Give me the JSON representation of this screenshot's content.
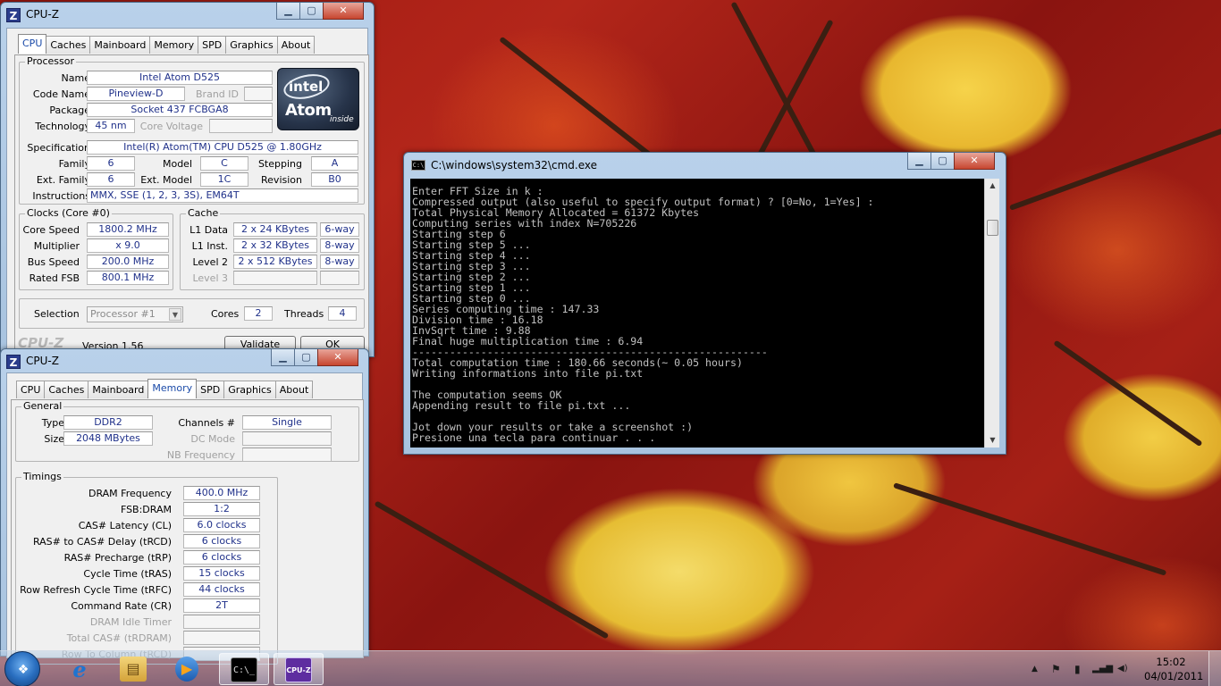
{
  "cpuz1": {
    "title": "CPU-Z",
    "controls": {
      "min": "▁",
      "max": "▢",
      "close": "✕"
    },
    "tabs": [
      "CPU",
      "Caches",
      "Mainboard",
      "Memory",
      "SPD",
      "Graphics",
      "About"
    ],
    "active_tab": "CPU",
    "processor": {
      "group_title": "Processor",
      "name_label": "Name",
      "name": "Intel Atom D525",
      "codename_label": "Code Name",
      "codename": "Pineview-D",
      "brandid_label": "Brand ID",
      "brandid": "",
      "package_label": "Package",
      "package": "Socket 437 FCBGA8",
      "technology_label": "Technology",
      "technology": "45 nm",
      "corevoltage_label": "Core Voltage",
      "corevoltage": "",
      "spec_label": "Specification",
      "spec": "Intel(R) Atom(TM) CPU D525   @ 1.80GHz",
      "family_label": "Family",
      "family": "6",
      "model_label": "Model",
      "model": "C",
      "stepping_label": "Stepping",
      "stepping": "A",
      "extfamily_label": "Ext. Family",
      "extfamily": "6",
      "extmodel_label": "Ext. Model",
      "extmodel": "1C",
      "revision_label": "Revision",
      "revision": "B0",
      "instructions_label": "Instructions",
      "instructions": "MMX, SSE (1, 2, 3, 3S), EM64T",
      "logo": {
        "brand": "intel",
        "product": "Atom",
        "suffix": "inside"
      }
    },
    "clocks": {
      "group_title": "Clocks (Core #0)",
      "corespeed_label": "Core Speed",
      "corespeed": "1800.2 MHz",
      "multiplier_label": "Multiplier",
      "multiplier": "x 9.0",
      "busspeed_label": "Bus Speed",
      "busspeed": "200.0 MHz",
      "ratedfsb_label": "Rated FSB",
      "ratedfsb": "800.1 MHz"
    },
    "cache": {
      "group_title": "Cache",
      "l1data_label": "L1 Data",
      "l1data": "2 x 24 KBytes",
      "l1data_way": "6-way",
      "l1inst_label": "L1 Inst.",
      "l1inst": "2 x 32 KBytes",
      "l1inst_way": "8-way",
      "level2_label": "Level 2",
      "level2": "2 x 512 KBytes",
      "level2_way": "8-way",
      "level3_label": "Level 3"
    },
    "selection_label": "Selection",
    "selection": "Processor #1",
    "cores_label": "Cores",
    "cores": "2",
    "threads_label": "Threads",
    "threads": "4",
    "brand": "CPU-Z",
    "version": "Version 1.56",
    "validate_button": "Validate",
    "ok_button": "OK"
  },
  "cpuz2": {
    "title": "CPU-Z",
    "tabs": [
      "CPU",
      "Caches",
      "Mainboard",
      "Memory",
      "SPD",
      "Graphics",
      "About"
    ],
    "active_tab": "Memory",
    "general": {
      "group_title": "General",
      "type_label": "Type",
      "type": "DDR2",
      "size_label": "Size",
      "size": "2048 MBytes",
      "channels_label": "Channels #",
      "channels": "Single",
      "dcmode_label": "DC Mode",
      "nbfreq_label": "NB Frequency"
    },
    "timings": {
      "group_title": "Timings",
      "rows": [
        {
          "label": "DRAM Frequency",
          "value": "400.0 MHz",
          "dim": false
        },
        {
          "label": "FSB:DRAM",
          "value": "1:2",
          "dim": false
        },
        {
          "label": "CAS# Latency (CL)",
          "value": "6.0 clocks",
          "dim": false
        },
        {
          "label": "RAS# to CAS# Delay (tRCD)",
          "value": "6 clocks",
          "dim": false
        },
        {
          "label": "RAS# Precharge (tRP)",
          "value": "6 clocks",
          "dim": false
        },
        {
          "label": "Cycle Time (tRAS)",
          "value": "15 clocks",
          "dim": false
        },
        {
          "label": "Row Refresh Cycle Time (tRFC)",
          "value": "44 clocks",
          "dim": false
        },
        {
          "label": "Command Rate (CR)",
          "value": "2T",
          "dim": false
        },
        {
          "label": "DRAM Idle Timer",
          "value": "",
          "dim": true
        },
        {
          "label": "Total CAS# (tRDRAM)",
          "value": "",
          "dim": true
        },
        {
          "label": "Row To Column (tRCD)",
          "value": "",
          "dim": true
        }
      ]
    }
  },
  "cmd": {
    "title": "C:\\windows\\system32\\cmd.exe",
    "lines": [
      "Enter FFT Size in k :",
      "Compressed output (also useful to specify output format) ? [0=No, 1=Yes] :",
      "Total Physical Memory Allocated = 61372 Kbytes",
      "Computing series with index N=705226",
      "Starting step 6",
      "Starting step 5 ...",
      "Starting step 4 ...",
      "Starting step 3 ...",
      "Starting step 2 ...",
      "Starting step 1 ...",
      "Starting step 0 ...",
      "Series computing time : 147.33",
      "Division time : 16.18",
      "InvSqrt time : 9.88",
      "Final huge multiplication time : 6.94",
      "---------------------------------------------------------",
      "Total computation time : 180.66 seconds(~ 0.05 hours)",
      "Writing informations into file pi.txt",
      "",
      "The computation seems OK",
      "Appending result to file pi.txt ...",
      "",
      "Jot down your results or take a screenshot :)",
      "Presione una tecla para continuar . . ."
    ]
  },
  "taskbar": {
    "pinned": [
      {
        "name": "ie-icon",
        "glyph": "e"
      },
      {
        "name": "explorer-icon",
        "glyph": "▤"
      },
      {
        "name": "media-player-icon",
        "glyph": "▶"
      },
      {
        "name": "cmd-icon",
        "glyph": "C:\\_"
      },
      {
        "name": "cpuz-icon",
        "glyph": "CPU-Z"
      }
    ],
    "tray": {
      "up_arrow": "▲",
      "flag": "⚑",
      "battery": "▮",
      "signal": "▂▄▆",
      "volume": "◀)"
    },
    "time": "15:02",
    "date": "04/01/2011"
  }
}
